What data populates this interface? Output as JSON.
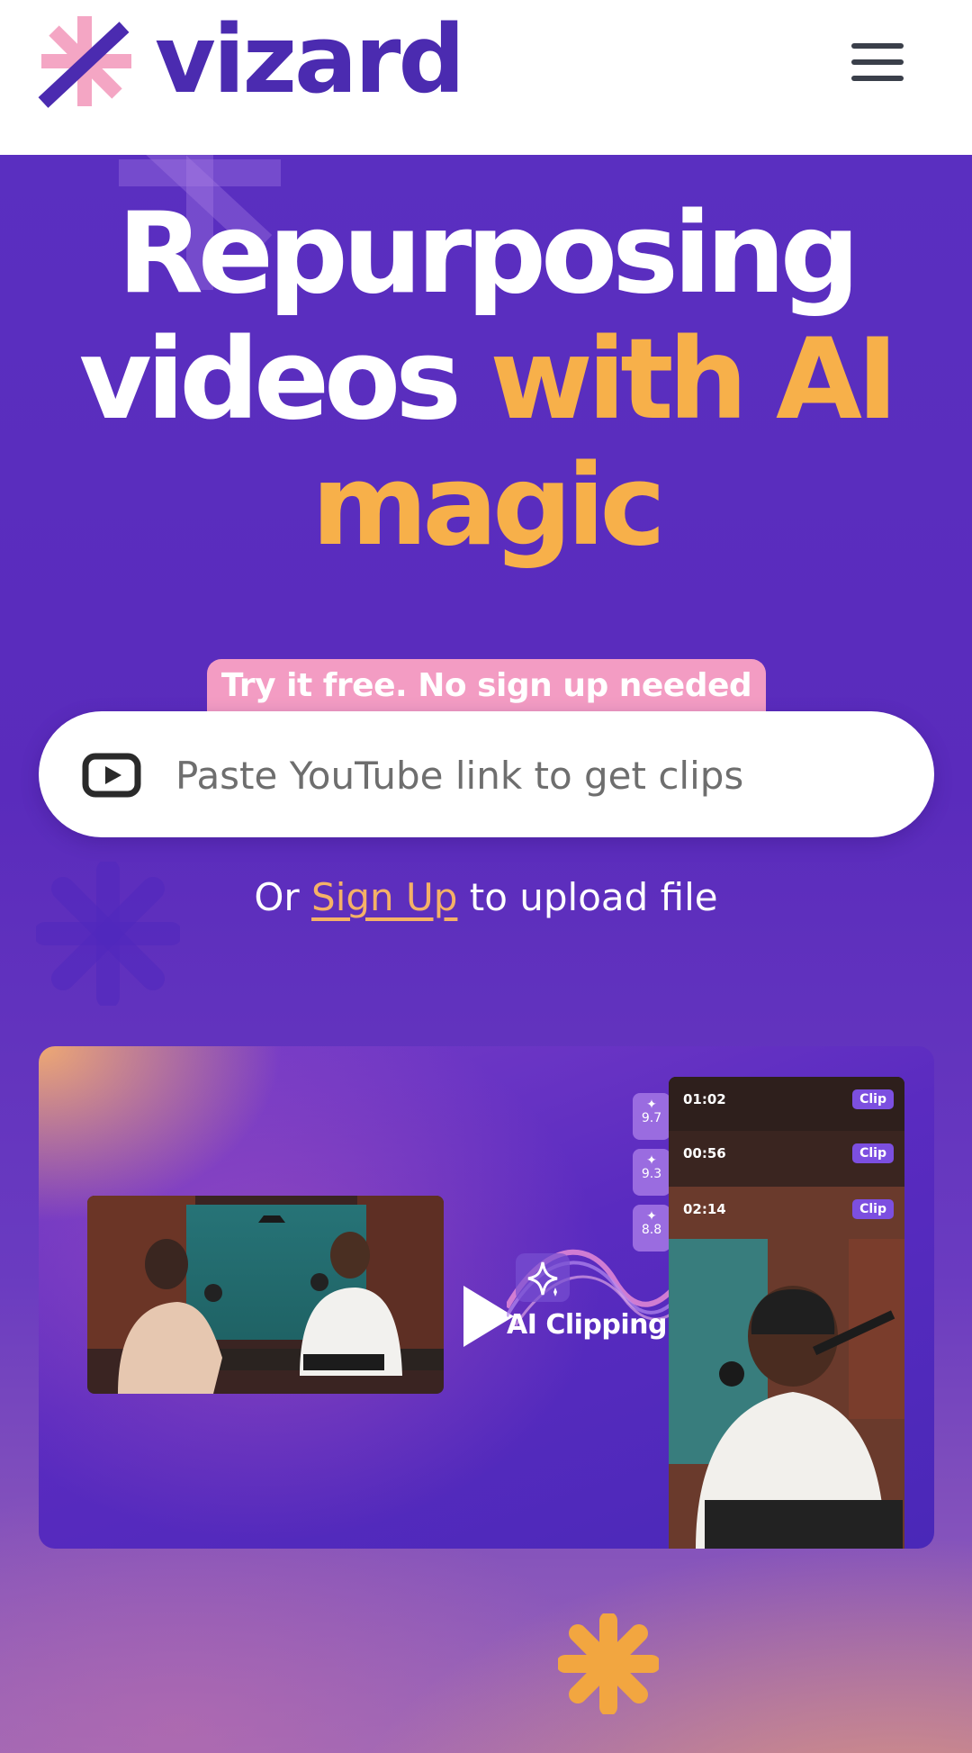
{
  "header": {
    "logo_text": "vizard",
    "menu_icon": "hamburger-menu-icon"
  },
  "hero": {
    "headline_line1": "Repurposing",
    "headline_line2_plain": "videos",
    "headline_line2_highlight": "with AI",
    "headline_line3_highlight": "magic",
    "badge": "Try it free. No sign up needed",
    "search": {
      "icon": "youtube-play-icon",
      "placeholder": "Paste YouTube link to get clips",
      "value": ""
    },
    "signup_prefix": "Or",
    "signup_link": "Sign Up",
    "signup_suffix": "to upload file"
  },
  "demo": {
    "center_label": "AI Clipping",
    "clips": [
      {
        "score": "9.7",
        "time": "01:02",
        "button": "Clip"
      },
      {
        "score": "9.3",
        "time": "00:56",
        "button": "Clip"
      },
      {
        "score": "8.8",
        "time": "02:14",
        "button": "Clip"
      }
    ]
  },
  "colors": {
    "brand_purple": "#4b2bb0",
    "brand_pink": "#f39cc3",
    "highlight_orange": "#f7b04a",
    "hero_background": "#5a2fc0"
  }
}
